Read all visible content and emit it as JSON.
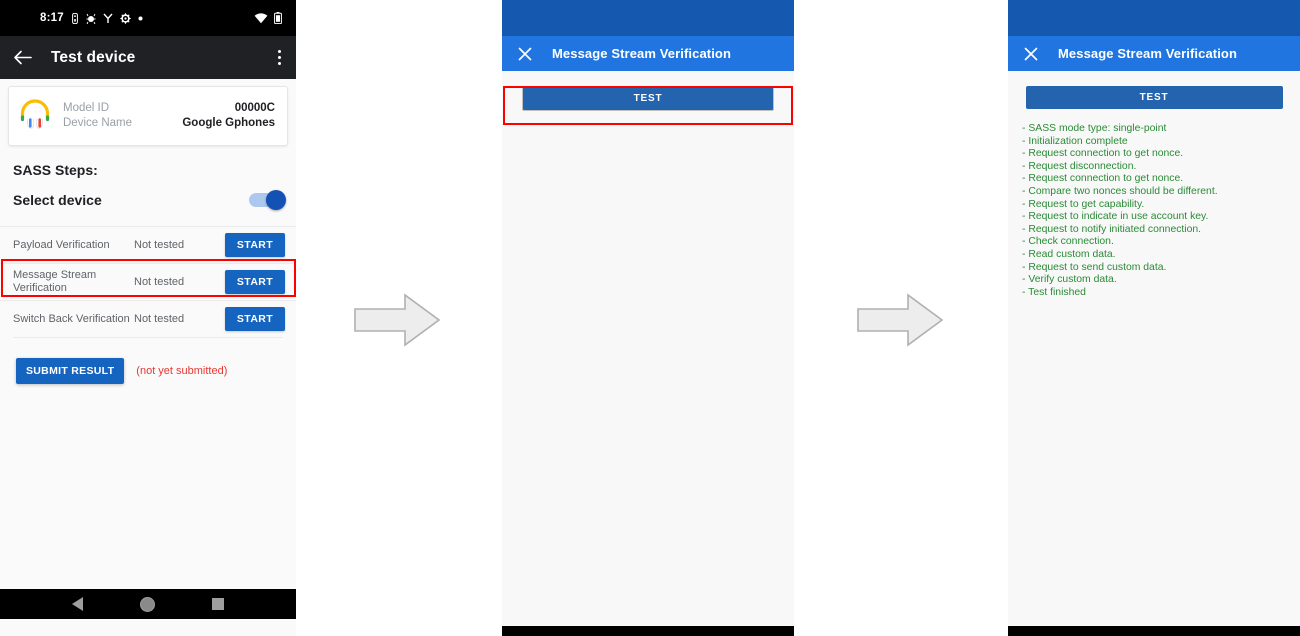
{
  "panel1": {
    "status_bar": {
      "time": "8:17",
      "icons": [
        "sim-icon",
        "debug-icon",
        "vpn-icon",
        "settings-icon",
        "dot-icon"
      ],
      "right_icons": [
        "wifi-icon",
        "battery-icon"
      ]
    },
    "app_bar": {
      "back_icon": "back-arrow-icon",
      "title": "Test device",
      "overflow_icon": "overflow-menu-icon"
    },
    "device_card": {
      "icon": "headphones-icon",
      "rows": [
        {
          "key": "Model ID",
          "value": "00000C"
        },
        {
          "key": "Device Name",
          "value": "Google Gphones"
        }
      ]
    },
    "sass_title": "SASS Steps:",
    "select_device": {
      "label": "Select device",
      "toggle_state": "on"
    },
    "steps": [
      {
        "name": "Payload Verification",
        "status": "Not tested",
        "button": "START"
      },
      {
        "name": "Message Stream Verification",
        "status": "Not tested",
        "button": "START"
      },
      {
        "name": "Switch Back Verification",
        "status": "Not tested",
        "button": "START"
      }
    ],
    "submit": {
      "button": "SUBMIT RESULT",
      "note": "(not yet submitted)"
    },
    "nav_bar": {
      "back": "nav-back-icon",
      "home": "nav-home-icon",
      "recents": "nav-recents-icon"
    }
  },
  "panel2": {
    "app_bar": {
      "close_icon": "close-icon",
      "title": "Message Stream Verification"
    },
    "test_button": "TEST",
    "log": ""
  },
  "panel3": {
    "app_bar": {
      "close_icon": "close-icon",
      "title": "Message Stream Verification"
    },
    "test_button": "TEST",
    "log_lines": [
      "- SASS mode type: single-point",
      "- Initialization complete",
      "- Request connection to get nonce.",
      "- Request disconnection.",
      "- Request connection to get nonce.",
      "- Compare two nonces should be different.",
      "- Request to get capability.",
      "- Request to indicate in use account key.",
      "- Request to notify initiated connection.",
      "- Check connection.",
      "- Read custom data.",
      "- Request to send custom data.",
      "- Verify custom data.",
      "- Test finished"
    ],
    "log": "- SASS mode type: single-point\n- Initialization complete\n- Request connection to get nonce.\n- Request disconnection.\n- Request connection to get nonce.\n- Compare two nonces should be different.\n- Request to get capability.\n- Request to indicate in use account key.\n- Request to notify initiated connection.\n- Check connection.\n- Read custom data.\n- Request to send custom data.\n- Verify custom data.\n- Test finished"
  },
  "annotations": {
    "highlight_1": "Message Stream Verification row highlighted",
    "highlight_2": "TEST button highlighted",
    "arrow_1": "flow-arrow-right",
    "arrow_2": "flow-arrow-right"
  },
  "colors": {
    "primary_blue": "#1565c0",
    "appbar_blue": "#2075e0",
    "statusbar_blue": "#1558b0",
    "highlight_red": "#ff0000",
    "log_green": "#2a8b36",
    "note_red": "#e53935"
  }
}
